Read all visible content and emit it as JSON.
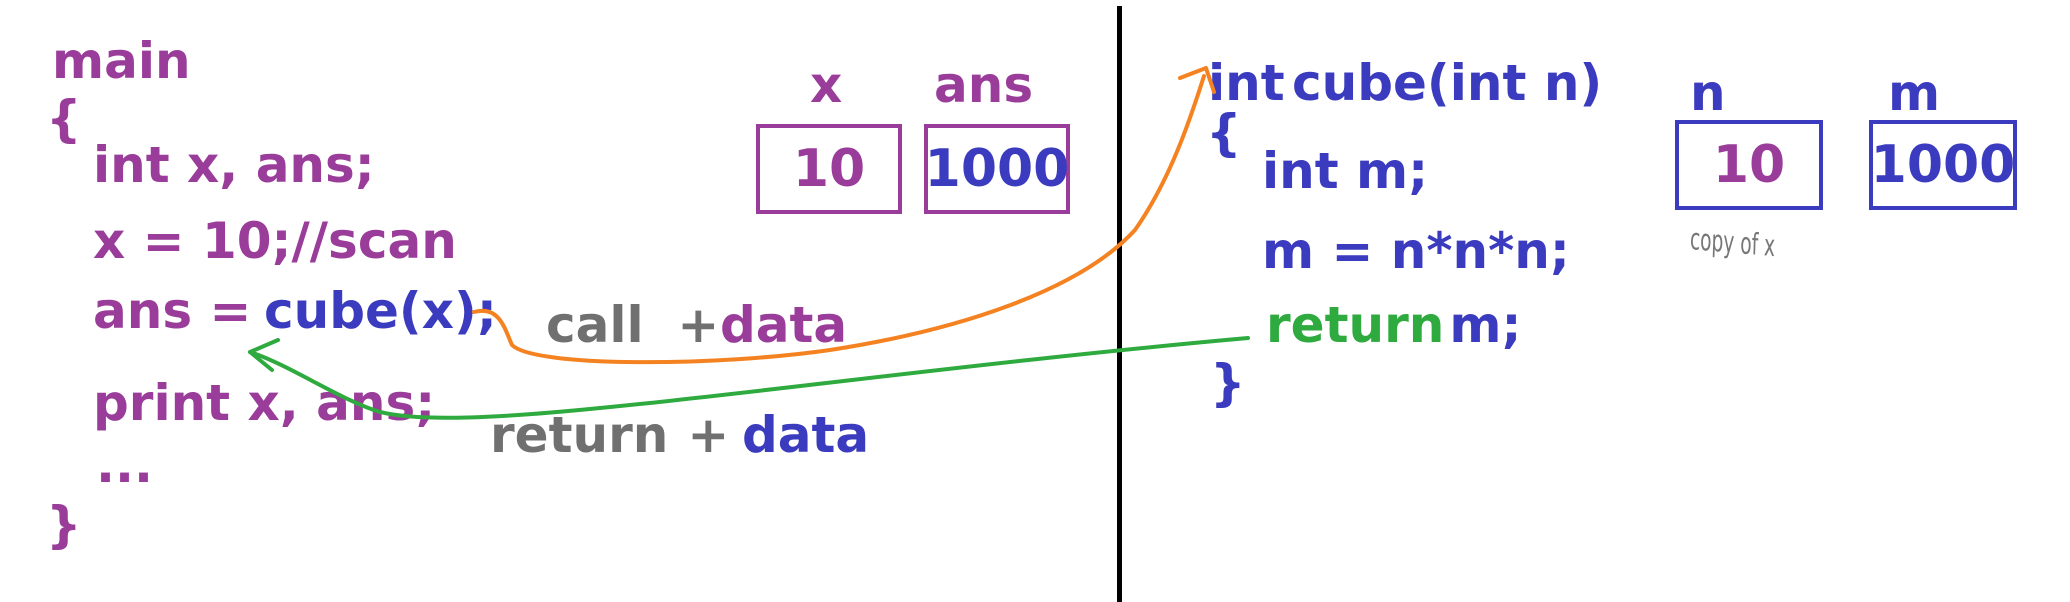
{
  "main_function": {
    "header": "main",
    "open_brace": "{",
    "line_declare": "int x, ans;",
    "line_assign_x": "x = 10;//scan",
    "line_call_lhs": "ans = ",
    "line_call_rhs": "cube(x);",
    "line_print": "print x, ans;",
    "line_ellipsis": "...",
    "close_brace": "}"
  },
  "main_variables": {
    "x_label": "x",
    "x_value": "10",
    "ans_label": "ans",
    "ans_value": "1000"
  },
  "cube_function": {
    "signature_int": "int",
    "signature_rest": "cube(int n)",
    "open_brace": "{",
    "line_declare": "int m;",
    "line_compute": "m = n*n*n;",
    "line_return_kw": "return",
    "line_return_var": " m;",
    "close_brace": "}"
  },
  "cube_variables": {
    "n_label": "n",
    "n_value": "10",
    "n_note": "copy of x",
    "m_label": "m",
    "m_value": "1000"
  },
  "annotations": {
    "call_word": "call",
    "call_plus": " + ",
    "call_data": "data",
    "return_word": "return",
    "return_plus": " + ",
    "return_data": "data"
  },
  "colors": {
    "main_code": "#9a3c99",
    "cube_code": "#3b3bbf",
    "return_keyword": "#2eaa3f",
    "call_arrow": "#f58220",
    "return_arrow": "#2eaa3f",
    "annotation_gray": "#707070",
    "divider": "#000000"
  }
}
